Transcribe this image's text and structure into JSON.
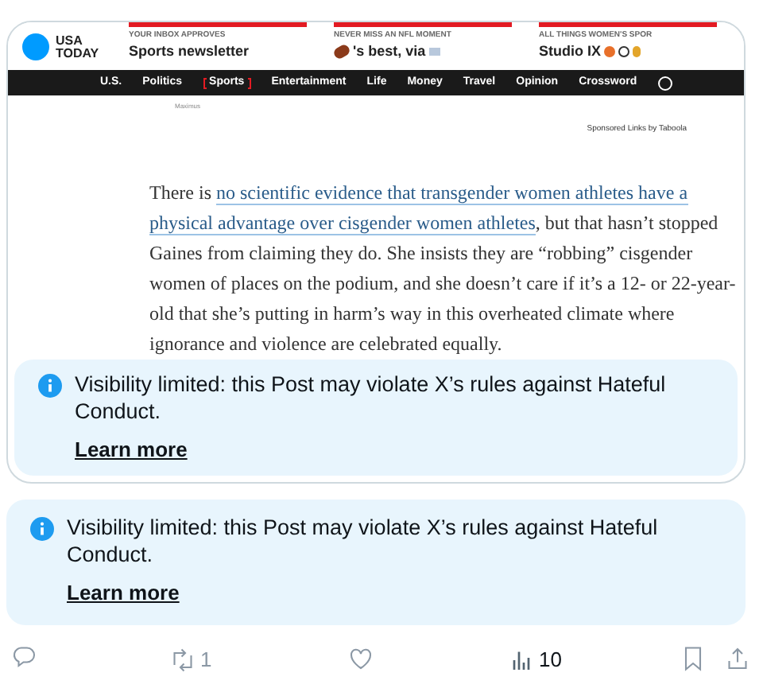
{
  "embedded_article": {
    "logo": "USA\nTODAY",
    "promos": [
      {
        "label": "YOUR INBOX APPROVES",
        "title": "Sports newsletter",
        "kind": "plain"
      },
      {
        "label": "NEVER MISS AN NFL MOMENT",
        "title": "'s best, via",
        "kind": "football"
      },
      {
        "label": "ALL THINGS WOMEN'S SPOR",
        "title": "Studio IX",
        "kind": "balls"
      }
    ],
    "nav": [
      {
        "label": "U.S.",
        "selected": false
      },
      {
        "label": "Politics",
        "selected": false
      },
      {
        "label": "Sports",
        "selected": true
      },
      {
        "label": "Entertainment",
        "selected": false
      },
      {
        "label": "Life",
        "selected": false
      },
      {
        "label": "Money",
        "selected": false
      },
      {
        "label": "Travel",
        "selected": false
      },
      {
        "label": "Opinion",
        "selected": false
      },
      {
        "label": "Crossword",
        "selected": false
      }
    ],
    "caption": "Maximus",
    "sponsored": "Sponsored Links by Taboola",
    "paragraph": [
      {
        "kind": "text",
        "text": "There is "
      },
      {
        "kind": "link",
        "text": "no scientific evidence that transgender women athletes have a"
      },
      {
        "kind": "link",
        "text": "physical advantage over cisgender women athletes"
      },
      {
        "kind": "text",
        "text": ", but that hasn’t stopped Gaines from claiming they do. She insists they are “robbing” cisgender women of places on the podium, and she doesn’t care if it’s a 12- or 22-year-old that she’s putting in harm’s way in this overheated climate where ignorance and violence are celebrated equally."
      }
    ]
  },
  "notices": [
    {
      "text": "Visibility limited: this Post may violate X’s rules against Hateful Conduct.",
      "link": "Learn more"
    },
    {
      "text": "Visibility limited: this Post may violate X’s rules against Hateful Conduct.",
      "link": "Learn more"
    }
  ],
  "actions": [
    {
      "kind": "reply"
    },
    {
      "kind": "repost",
      "count": "1"
    },
    {
      "kind": "like"
    },
    {
      "kind": "views",
      "count": "10"
    },
    {
      "kind": "bookmark"
    },
    {
      "kind": "share"
    }
  ]
}
